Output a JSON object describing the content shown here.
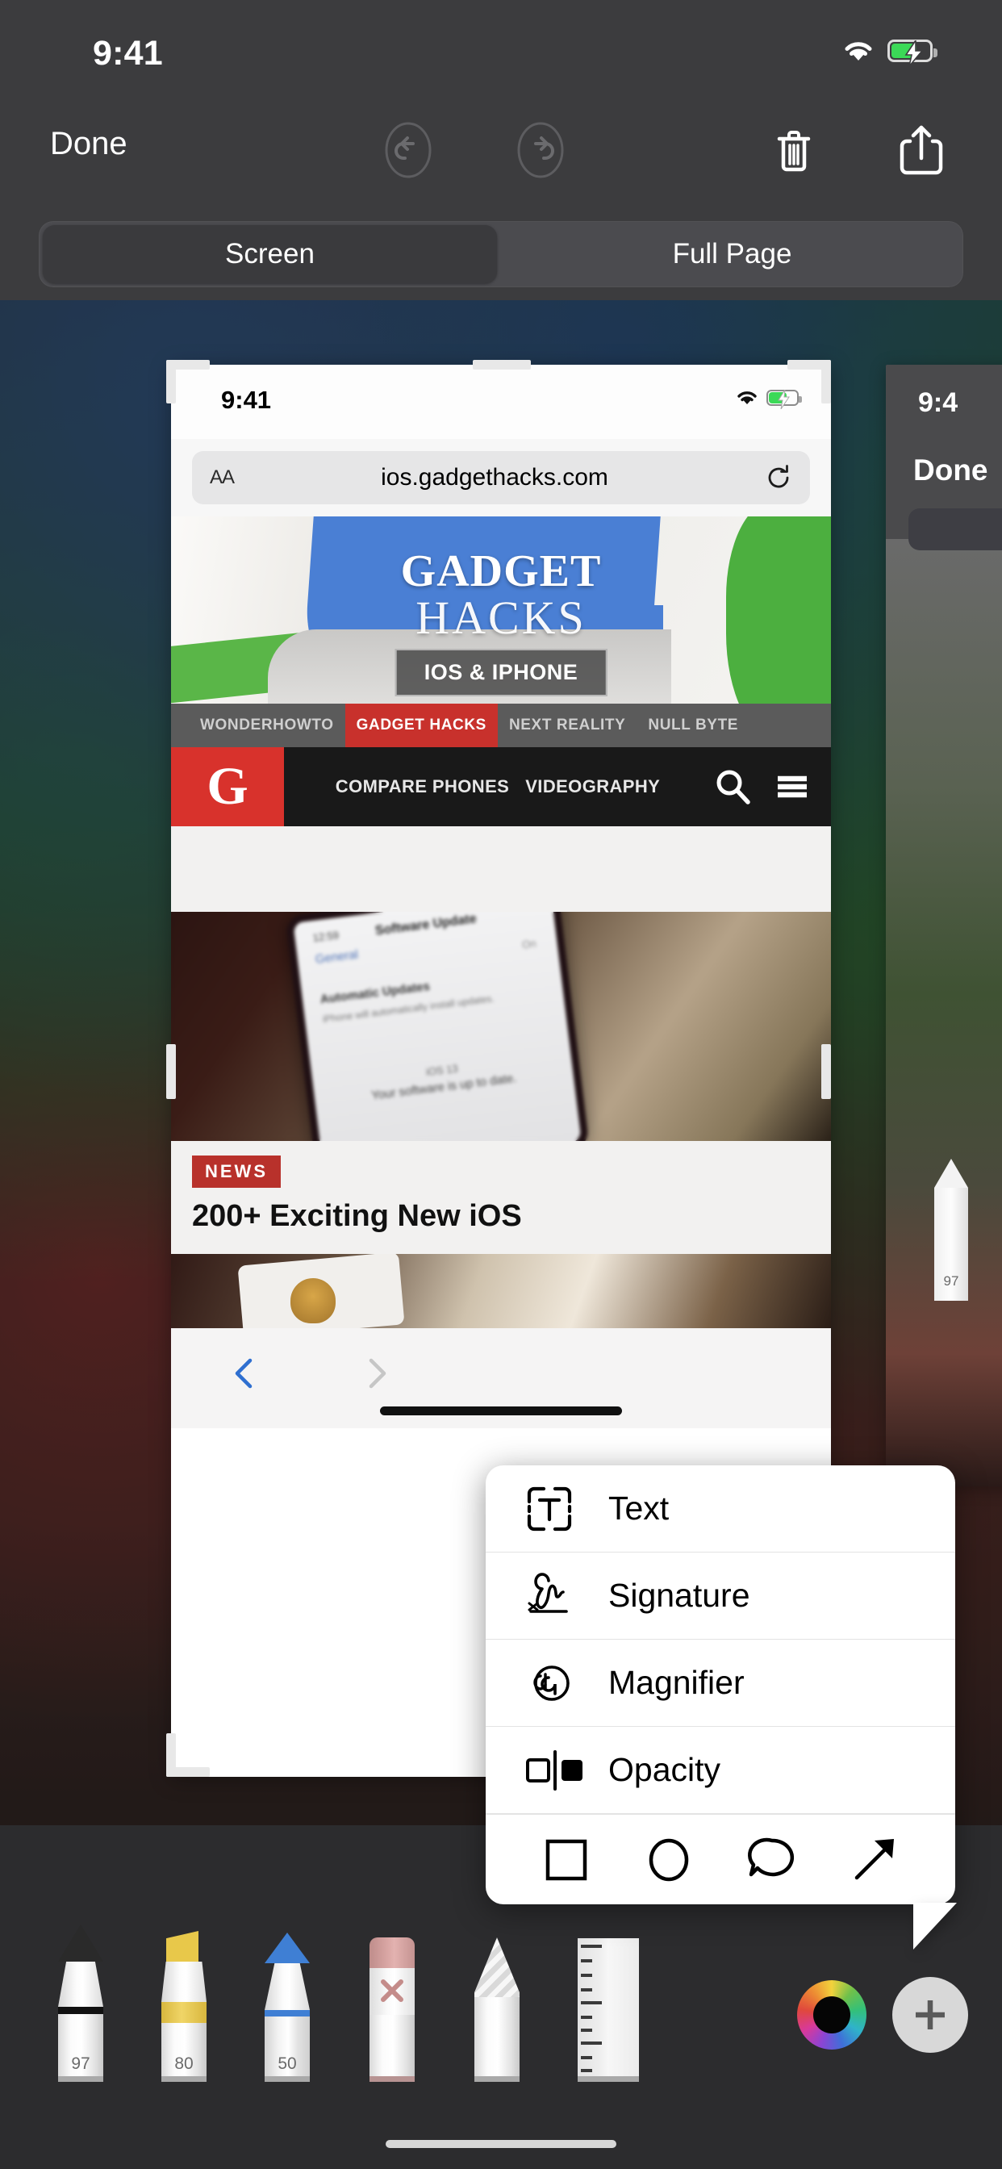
{
  "statusbar": {
    "time": "9:41",
    "wifi_icon": "wifi-icon",
    "battery_icon": "battery-charging-icon"
  },
  "toolbar": {
    "done_label": "Done",
    "undo_icon": "undo-icon",
    "redo_icon": "redo-icon",
    "trash_icon": "trash-icon",
    "share_icon": "share-icon"
  },
  "segmented": {
    "options": [
      {
        "label": "Screen",
        "selected": true
      },
      {
        "label": "Full Page",
        "selected": false
      }
    ]
  },
  "screenshot": {
    "statusbar": {
      "time": "9:41",
      "wifi_icon": "wifi-icon",
      "battery_icon": "battery-charging-icon"
    },
    "urlbar": {
      "text_size_label": "AA",
      "url": "ios.gadgethacks.com",
      "reload_icon": "reload-icon"
    },
    "banner": {
      "title_top": "GADGET",
      "title_bottom": "HACKS",
      "chip": "IOS & IPHONE"
    },
    "sitenav": [
      {
        "label": "WONDERHOWTO",
        "active": false
      },
      {
        "label": "GADGET HACKS",
        "active": true
      },
      {
        "label": "NEXT REALITY",
        "active": false
      },
      {
        "label": "NULL BYTE",
        "active": false
      }
    ],
    "brandnav": {
      "logo": "G",
      "links": [
        "COMPARE PHONES",
        "VIDEOGRAPHY"
      ],
      "search_icon": "search-icon",
      "menu_icon": "hamburger-menu-icon"
    },
    "article_photo": {
      "status_time": "12:59",
      "back_label": "General",
      "title": "Software Update",
      "toggle_value": "On",
      "section": "Automatic Updates",
      "section_note": "iPhone will automatically install updates.",
      "version": "iOS 13",
      "status": "Your software is up to date."
    },
    "news": {
      "badge": "NEWS",
      "headline": "200+ Exciting New iOS"
    },
    "safari_bottom": {
      "back_icon": "chevron-left-icon",
      "forward_icon": "chevron-right-icon"
    }
  },
  "screenshot_right": {
    "time": "9:4",
    "done_label": "Done",
    "tool_number": "97"
  },
  "popup": {
    "items": [
      {
        "label": "Text",
        "icon": "text-box-icon"
      },
      {
        "label": "Signature",
        "icon": "signature-icon"
      },
      {
        "label": "Magnifier",
        "icon": "magnifier-icon"
      },
      {
        "label": "Opacity",
        "icon": "opacity-icon"
      }
    ],
    "shapes": [
      {
        "name": "square-shape-icon"
      },
      {
        "name": "circle-shape-icon"
      },
      {
        "name": "speech-bubble-shape-icon"
      },
      {
        "name": "arrow-shape-icon"
      }
    ]
  },
  "tools": [
    {
      "name": "pen-tool",
      "number": "97",
      "color": "#1c1c1c"
    },
    {
      "name": "highlighter-tool",
      "number": "80",
      "color": "#e8c84a"
    },
    {
      "name": "pencil-tool",
      "number": "50",
      "color": "#3f7fd4"
    },
    {
      "name": "eraser-tool",
      "number": "",
      "color": "#cf9a98"
    },
    {
      "name": "lasso-tool",
      "number": "",
      "color": "#cccccc"
    },
    {
      "name": "ruler-tool",
      "number": "",
      "color": "#dddddd"
    }
  ],
  "color_picker": {
    "name": "color-wheel",
    "selected_color": "#000000"
  },
  "add_button": {
    "label": "+",
    "name": "add-markup-button"
  }
}
